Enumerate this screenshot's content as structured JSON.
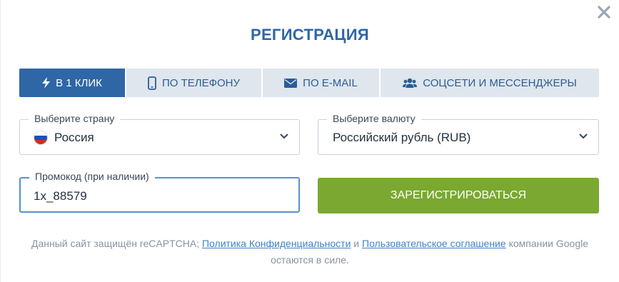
{
  "modal": {
    "title": "РЕГИСТРАЦИЯ",
    "close_icon": "close-icon"
  },
  "tabs": [
    {
      "label": "В 1 КЛИК",
      "icon": "lightning-icon",
      "active": true
    },
    {
      "label": "ПО ТЕЛЕФОНУ",
      "icon": "phone-icon",
      "active": false
    },
    {
      "label": "ПО E-MAIL",
      "icon": "envelope-icon",
      "active": false
    },
    {
      "label": "СОЦСЕТИ И МЕССЕНДЖЕРЫ",
      "icon": "users-icon",
      "active": false
    }
  ],
  "form": {
    "country_label": "Выберите страну",
    "country_value": "Россия",
    "currency_label": "Выберите валюту",
    "currency_value": "Российский рубль (RUB)",
    "promo_label": "Промокод (при наличии)",
    "promo_value": "1x_88579",
    "register_label": "ЗАРЕГИСТРИРОВАТЬСЯ"
  },
  "note": {
    "text_1": "Данный сайт защищён reCAPTCHA;",
    "privacy_link": "Политика Конфиденциальности",
    "text_2": "и",
    "terms_link": "Пользовательское соглашение",
    "text_3": "компании Google остаются в силе."
  },
  "colors": {
    "primary": "#2f66a6",
    "tab_bg": "#dfe6ee",
    "register_button": "#7aa830",
    "link": "#3d83c9"
  }
}
